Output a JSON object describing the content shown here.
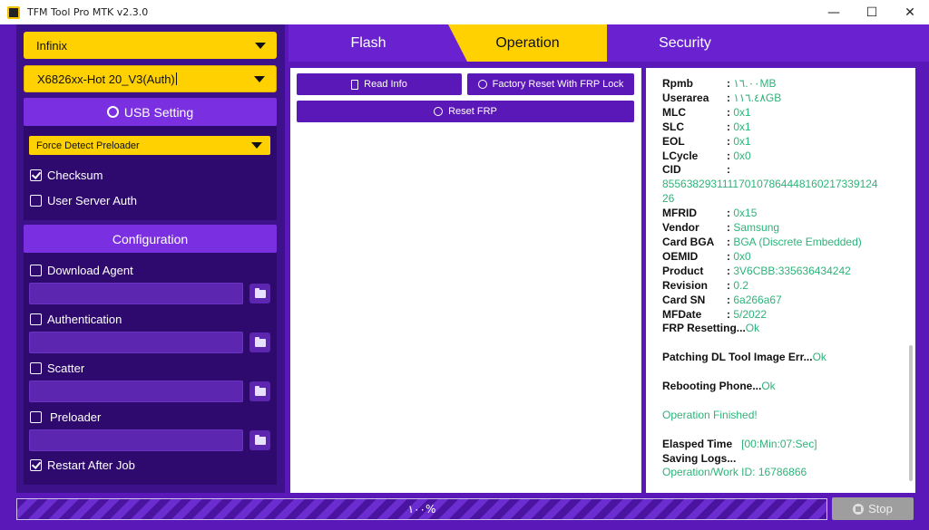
{
  "window": {
    "title": "TFM Tool Pro MTK v2.3.0",
    "minimize": "—",
    "maximize": "☐",
    "close": "✕"
  },
  "left": {
    "brand_select": "Infinix",
    "model_select": "X6826xx-Hot 20_V3(Auth)",
    "usb_header": "USB Setting",
    "preloader_mode": "Force Detect Preloader",
    "checksum_label": "Checksum",
    "checksum_checked": true,
    "user_server_auth_label": "User Server Auth",
    "user_server_auth_checked": false,
    "config_header": "Configuration",
    "download_agent_label": "Download Agent",
    "authentication_label": "Authentication",
    "scatter_label": "Scatter",
    "preloader_label": "Preloader",
    "restart_label": "Restart After Job",
    "restart_checked": true
  },
  "tabs": [
    {
      "label": "Flash",
      "active": false
    },
    {
      "label": "Operation",
      "active": true
    },
    {
      "label": "Security",
      "active": false
    }
  ],
  "operation": {
    "read_info": "Read Info",
    "factory_reset": "Factory Reset With FRP Lock",
    "reset_frp": "Reset FRP"
  },
  "log": {
    "rpmb_k": "Rpmb",
    "rpmb_v": "١٦.٠٠MB",
    "userarea_k": "Userarea",
    "userarea_v": "١١٦.٤٨GB",
    "mlc_k": "MLC",
    "mlc_v": "0x1",
    "slc_k": "SLC",
    "slc_v": "0x1",
    "eol_k": "EOL",
    "eol_v": "0x1",
    "lcycle_k": "LCycle",
    "lcycle_v": "0x0",
    "cid_k": "CID",
    "cid_v1": "855638293111170107864448160217339124",
    "cid_v2": "26",
    "mfrid_k": "MFRID",
    "mfrid_v": "0x15",
    "vendor_k": "Vendor",
    "vendor_v": "Samsung",
    "cardbga_k": "Card BGA",
    "cardbga_v": "BGA (Discrete Embedded)",
    "oemid_k": "OEMID",
    "oemid_v": "0x0",
    "product_k": "Product",
    "product_v": "3V6CBB:335636434242",
    "revision_k": "Revision",
    "revision_v": "0.2",
    "cardsn_k": "Card SN",
    "cardsn_v": "6a266a67",
    "mfdate_k": "MFDate",
    "mfdate_v": "5/2022",
    "frp_reset": "FRP Resetting...",
    "frp_reset_ok": "Ok",
    "patching": "Patching DL Tool Image Err...",
    "patching_ok": "Ok",
    "rebooting": "Rebooting Phone...",
    "rebooting_ok": "Ok",
    "finished": "Operation Finished!",
    "elapsed_k": "Elasped Time",
    "elapsed_v": "[00:Min:07:Sec]",
    "saving": "Saving Logs...",
    "work_id": "Operation/Work ID: 16786866"
  },
  "bottom": {
    "progress_text": "١٠٠%",
    "progress_value": 100,
    "stop_label": "Stop"
  },
  "colors": {
    "purple_dark": "#3d118a",
    "purple": "#5b18b8",
    "accent_yellow": "#ffd100",
    "log_green": "#2db37a"
  }
}
